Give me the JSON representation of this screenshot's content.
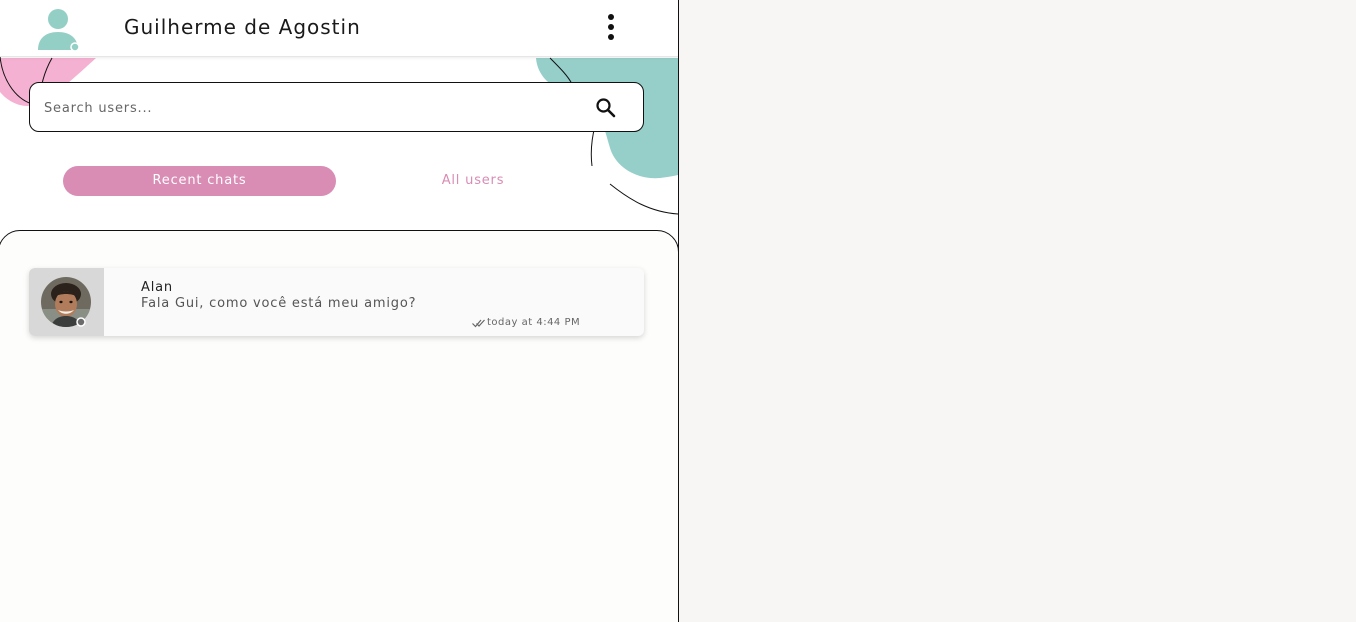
{
  "header": {
    "user_name": "Guilherme de Agostin",
    "avatar_icon": "user-silhouette-icon",
    "menu_icon": "vertical-dots-icon"
  },
  "search": {
    "placeholder": "Search users...",
    "value": "",
    "icon": "search-icon"
  },
  "tabs": [
    {
      "label": "Recent chats",
      "active": true
    },
    {
      "label": "All users",
      "active": false
    }
  ],
  "chats": [
    {
      "name": "Alan",
      "message": "Fala Gui, como você está meu amigo?",
      "time": "today at 4:44 PM",
      "status_icon": "double-check-icon"
    }
  ],
  "colors": {
    "accent_pink": "#d98cb4",
    "blob_pink": "#f4b1d1",
    "blob_teal": "#96cfc9",
    "avatar_teal": "#94cfc6",
    "right_panel_bg": "#f7f6f4"
  }
}
